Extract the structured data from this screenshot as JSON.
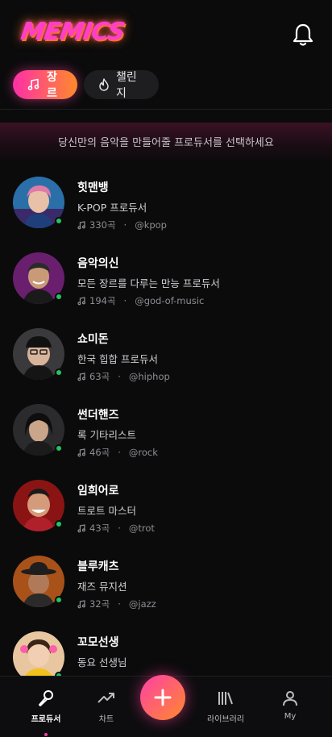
{
  "app": {
    "logo_text": "MEMICS"
  },
  "chips": [
    {
      "label": "장르",
      "icon": "music-note-icon",
      "active": true
    },
    {
      "label": "챌린지",
      "icon": "flame-icon",
      "active": false
    }
  ],
  "banner": {
    "text": "당신만의 음악을 만들어줄 프로듀서를 선택하세요"
  },
  "producers": [
    {
      "name": "힛맨뱅",
      "desc": "K-POP 프로듀서",
      "songs": "330곡",
      "handle": "@kpop",
      "online": true
    },
    {
      "name": "음악의신",
      "desc": "모든 장르를 다루는 만능 프로듀서",
      "songs": "194곡",
      "handle": "@god-of-music",
      "online": true
    },
    {
      "name": "쇼미돈",
      "desc": "한국 힙합 프로듀서",
      "songs": "63곡",
      "handle": "@hiphop",
      "online": true
    },
    {
      "name": "썬더핸즈",
      "desc": "록 기타리스트",
      "songs": "46곡",
      "handle": "@rock",
      "online": true
    },
    {
      "name": "임희어로",
      "desc": "트로트 마스터",
      "songs": "43곡",
      "handle": "@trot",
      "online": true
    },
    {
      "name": "블루캐츠",
      "desc": "재즈 뮤지션",
      "songs": "32곡",
      "handle": "@jazz",
      "online": true
    },
    {
      "name": "꼬모선생",
      "desc": "동요 선생님",
      "songs": "",
      "handle": "",
      "online": true
    }
  ],
  "tabbar": {
    "items": [
      {
        "label": "프로듀서",
        "icon": "microphone-icon",
        "active": true
      },
      {
        "label": "차트",
        "icon": "trending-up-icon",
        "active": false
      },
      {
        "label": "",
        "icon": "plus-icon",
        "active": false
      },
      {
        "label": "라이브러리",
        "icon": "library-icon",
        "active": false
      },
      {
        "label": "My",
        "icon": "user-icon",
        "active": false
      }
    ]
  },
  "colors": {
    "accent_pink": "#ff2fa8",
    "accent_orange": "#ff8a2a",
    "online": "#22c55e",
    "background": "#0b0b0c"
  }
}
